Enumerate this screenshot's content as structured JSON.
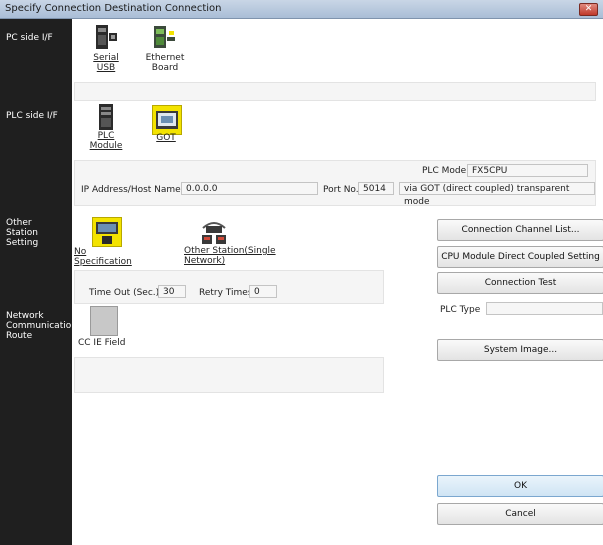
{
  "window": {
    "title": "Specify Connection Destination Connection",
    "close_glyph": "✕"
  },
  "sections": {
    "pc_side": "PC side I/F",
    "plc_side": "PLC side I/F",
    "other_station": [
      "Other",
      "Station",
      "Setting"
    ],
    "network_route": [
      "Network",
      "Communication",
      "Route"
    ]
  },
  "pc_side_options": [
    {
      "label": [
        "Serial",
        "USB"
      ],
      "icon": "serial-usb-icon",
      "selected": true
    },
    {
      "label": [
        "Ethernet",
        "Board"
      ],
      "icon": "ethernet-board-icon",
      "selected": false
    }
  ],
  "plc_side_options": [
    {
      "label": [
        "PLC",
        "Module"
      ],
      "icon": "plc-module-icon",
      "selected": false
    },
    {
      "label": [
        "GOT"
      ],
      "icon": "got-icon",
      "selected": true
    }
  ],
  "plc_details": {
    "plc_mode_label": "PLC Mode",
    "plc_mode_value": "FX5CPU",
    "ip_label": "IP Address/Host Name",
    "ip_value": "0.0.0.0",
    "port_label": "Port No.",
    "port_value": "5014",
    "mode_text": "via GOT (direct coupled) transparent mode"
  },
  "other_station_options": [
    {
      "label": [
        "No Specification"
      ],
      "icon": "no-specification-icon",
      "selected": true
    },
    {
      "label": [
        "Other Station(Single",
        "Network)"
      ],
      "icon": "other-station-icon",
      "selected": false
    }
  ],
  "timeout": {
    "label": "Time Out (Sec.)",
    "value": "30",
    "retry_label": "Retry Times",
    "retry_value": "0"
  },
  "network_options": [
    {
      "label": "CC IE Field",
      "icon": "cc-ie-field-icon"
    }
  ],
  "buttons": {
    "connection_channel_list": "Connection Channel List...",
    "cpu_direct": "CPU Module Direct Coupled Setting",
    "connection_test": "Connection Test",
    "system_image": "System Image...",
    "ok": "OK",
    "cancel": "Cancel"
  },
  "plc_type": {
    "label": "PLC Type",
    "value": ""
  },
  "colors": {
    "left_bar": "#1f1f1f",
    "selected_icon_bg": "#f3e300",
    "title_bar": "#b8c9de"
  }
}
